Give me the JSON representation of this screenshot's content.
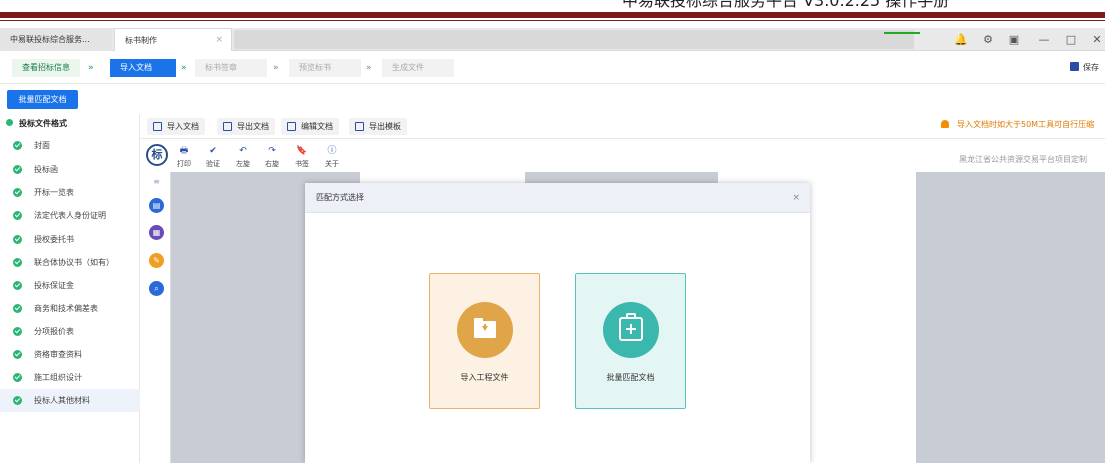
{
  "doc_header": {
    "title": "中易联投标综合服务平台 V3.0.2.25 操作手册"
  },
  "tabs": [
    {
      "label": "中易联投标综合服务..."
    },
    {
      "label": "标书制作",
      "close": "×"
    }
  ],
  "window_controls": {
    "bell": "🔔",
    "gear": "⚙",
    "monitor": "▣",
    "minimize": "—",
    "restore": "□",
    "close": "✕"
  },
  "steps": [
    {
      "label": "查看招标信息",
      "state": "done"
    },
    {
      "label": "导入文档",
      "state": "active"
    },
    {
      "label": "标书签章",
      "state": "todo"
    },
    {
      "label": "预览标书",
      "state": "todo"
    },
    {
      "label": "生成文件",
      "state": "todo"
    }
  ],
  "step_arrows": [
    "»",
    "»",
    "»",
    "»"
  ],
  "save_label": "保存",
  "batch_button": "批量匹配文档",
  "sidebar": {
    "header": "投标文件格式",
    "items": [
      {
        "label": "封面"
      },
      {
        "label": "投标函"
      },
      {
        "label": "开标一览表"
      },
      {
        "label": "法定代表人身份证明"
      },
      {
        "label": "授权委托书"
      },
      {
        "label": "联合体协议书（如有）"
      },
      {
        "label": "投标保证金"
      },
      {
        "label": "商务和技术偏差表"
      },
      {
        "label": "分项报价表"
      },
      {
        "label": "资格审查资料"
      },
      {
        "label": "施工组织设计"
      },
      {
        "label": "投标人其他材料"
      }
    ]
  },
  "toolbar": {
    "buttons": [
      {
        "label": "导入文档"
      },
      {
        "label": "导出文档"
      },
      {
        "label": "编辑文档"
      },
      {
        "label": "导出模板"
      }
    ],
    "notice": "导入文档时如大于50M工具可自行压缩"
  },
  "viewer": {
    "logo": "标",
    "tools": [
      {
        "label": "打印",
        "glyph": "🖶"
      },
      {
        "label": "验证",
        "glyph": "✔"
      },
      {
        "label": "左旋",
        "glyph": "↶"
      },
      {
        "label": "右旋",
        "glyph": "↷"
      },
      {
        "label": "书签",
        "glyph": "🔖"
      },
      {
        "label": "关于",
        "glyph": "ⓘ"
      }
    ],
    "provider": "黑龙江省公共资源交易平台项目定制",
    "side_icons": [
      {
        "glyph": "≡",
        "color": "#9aa6c0"
      },
      {
        "glyph": "▤",
        "color": "#2a6ad8"
      },
      {
        "glyph": "▦",
        "color": "#6a4ab8"
      },
      {
        "glyph": "✎",
        "color": "#f0a020"
      },
      {
        "glyph": "⌕",
        "color": "#2a6ad8"
      }
    ]
  },
  "modal": {
    "title": "匹配方式选择",
    "close": "×",
    "options": [
      {
        "label": "导入工程文件",
        "icon": "folder-import-icon"
      },
      {
        "label": "批量匹配文档",
        "icon": "plus-box-icon"
      }
    ]
  }
}
